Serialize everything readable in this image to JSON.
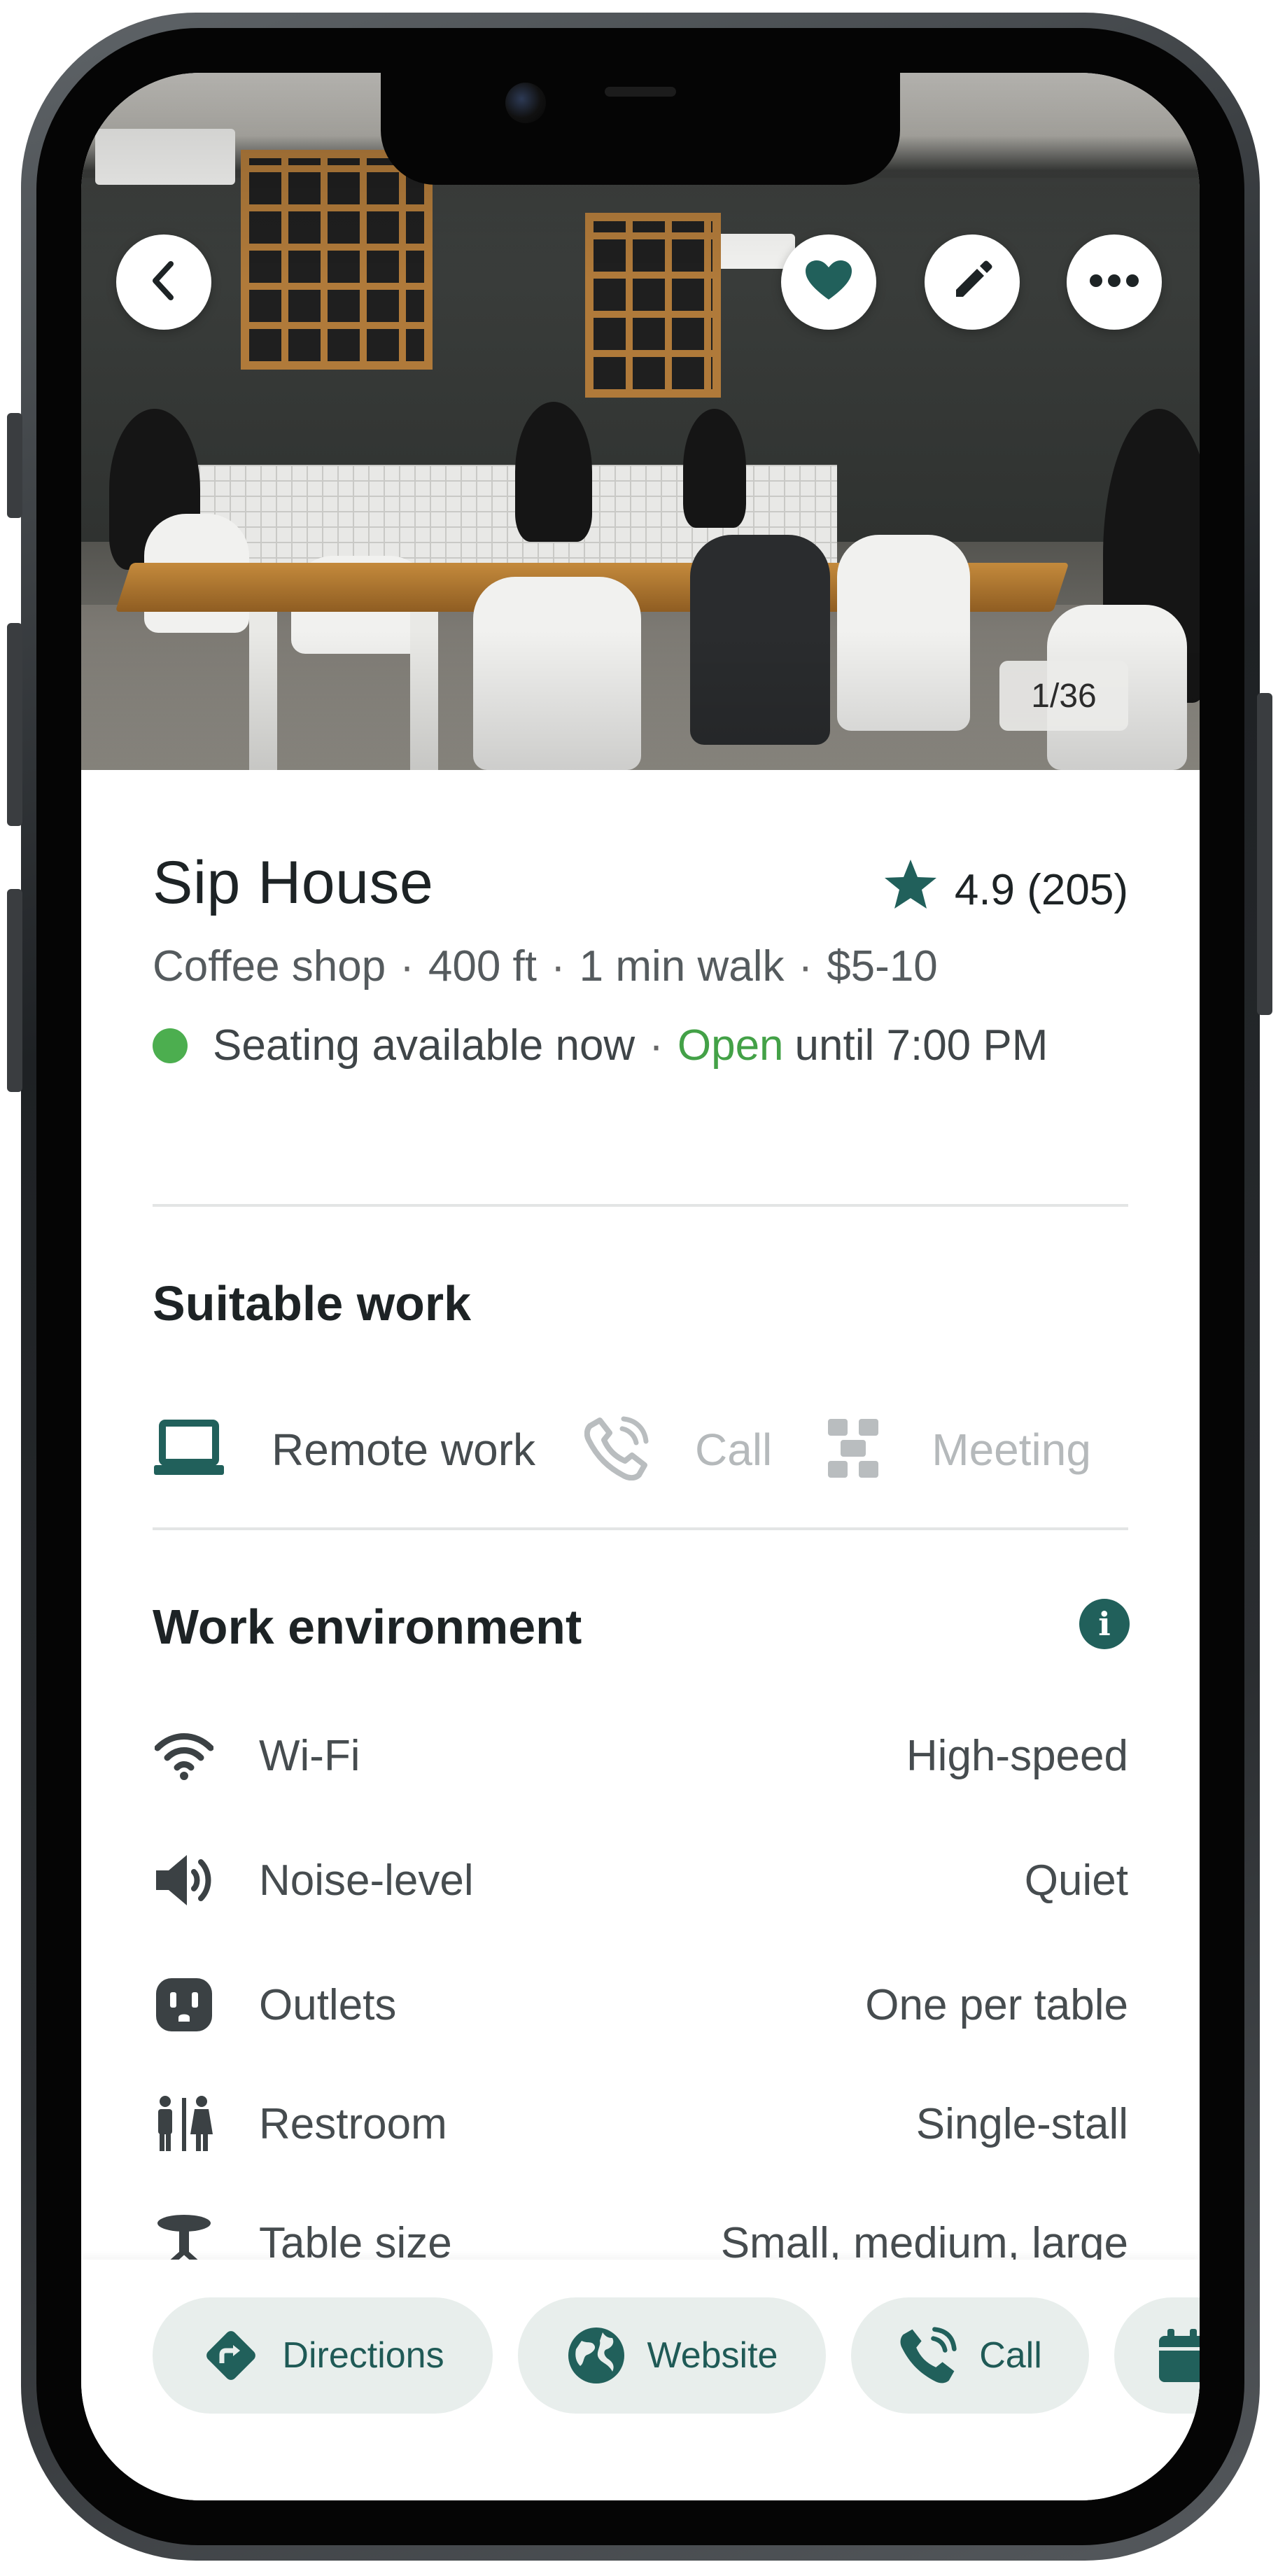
{
  "hero": {
    "photo_counter": "1/36",
    "buttons": {
      "back_icon": "chevron-left-icon",
      "favorite_icon": "heart-icon",
      "edit_icon": "pencil-icon",
      "more_icon": "ellipsis-icon"
    }
  },
  "place": {
    "name": "Sip House",
    "rating": "4.9 (205)",
    "meta": {
      "category": "Coffee shop",
      "distance": "400 ft",
      "walk": "1 min walk",
      "price": "$5-10"
    },
    "status": {
      "seating": "Seating available now",
      "open_label": "Open",
      "hours": "until 7:00 PM"
    }
  },
  "suitable_work": {
    "title": "Suitable work",
    "items": [
      {
        "label": "Remote work",
        "icon": "laptop-icon",
        "active": true
      },
      {
        "label": "Call",
        "icon": "phone-icon",
        "active": false
      },
      {
        "label": "Meeting",
        "icon": "meeting-icon",
        "active": false
      }
    ]
  },
  "work_environment": {
    "title": "Work environment",
    "info_icon": "info-icon",
    "rows": [
      {
        "label": "Wi-Fi",
        "value": "High-speed",
        "icon": "wifi-icon"
      },
      {
        "label": "Noise-level",
        "value": "Quiet",
        "icon": "speaker-icon"
      },
      {
        "label": "Outlets",
        "value": "One per table",
        "icon": "outlet-icon"
      },
      {
        "label": "Restroom",
        "value": "Single-stall",
        "icon": "restroom-icon"
      },
      {
        "label": "Table size",
        "value": "Small, medium, large",
        "icon": "table-icon"
      }
    ]
  },
  "actions": {
    "directions": "Directions",
    "website": "Website",
    "call": "Call"
  },
  "colors": {
    "accent": "#21605b",
    "open_green": "#43a147",
    "status_dot": "#4cae4f",
    "action_bg": "#e8eeec",
    "muted_icon": "#b9bdbf"
  }
}
